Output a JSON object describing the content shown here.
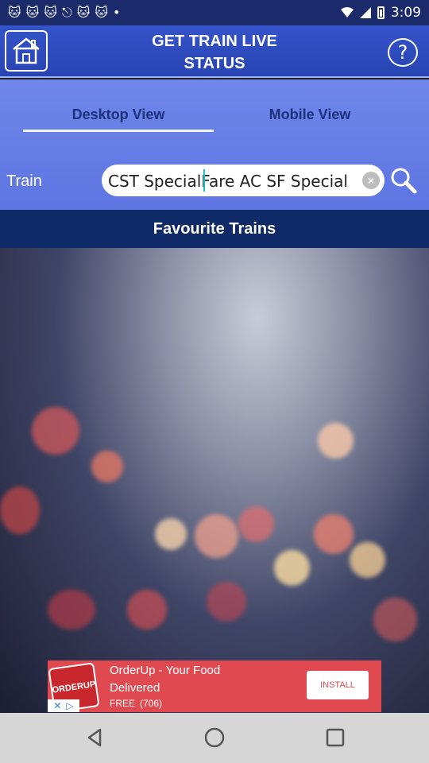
{
  "status_bar": {
    "time": "3:09",
    "notification_icons": [
      "cat-icon",
      "cat-icon",
      "cat-icon",
      "esc-icon",
      "cat-icon",
      "cat-icon",
      "dot-icon"
    ]
  },
  "header": {
    "title_line1": "GET TRAIN LIVE",
    "title_line2": "STATUS",
    "home_icon": "home-icon",
    "help_icon": "help-icon",
    "help_glyph": "?"
  },
  "tabs": {
    "desktop_label": "Desktop View",
    "mobile_label": "Mobile View",
    "selected": "Desktop View"
  },
  "search": {
    "label": "Train",
    "value": "CST SpecialFare AC SF Special",
    "clear_glyph": "×"
  },
  "favourites": {
    "title": "Favourite Trains"
  },
  "ad": {
    "logo_text": "ORDERUP",
    "title": "OrderUp - Your Food",
    "line2": "Delivered",
    "price": "FREE",
    "rating_count": "(706)",
    "install_label": "INSTALL"
  },
  "nav": {
    "back_icon": "back-icon",
    "home_icon": "home-circle-icon",
    "recents_icon": "recents-icon"
  },
  "colors": {
    "header_blue": "#2844b3",
    "panel_blue": "#6f86ea",
    "fav_bar": "#0f2a66",
    "ad_red": "#e0494f",
    "nav_gray": "#d6d6d6"
  }
}
